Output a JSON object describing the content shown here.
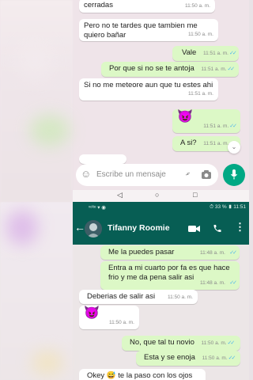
{
  "top_chat": {
    "messages": [
      {
        "dir": "in",
        "text": "cerradas",
        "time": "11:50 a. m."
      },
      {
        "dir": "in",
        "text": "Pero no te tardes que tambien me",
        "text2": "quiero bañar",
        "time": "11:50 a. m."
      },
      {
        "dir": "out",
        "text": "Vale",
        "time": "11:51 a. m."
      },
      {
        "dir": "out",
        "text": "Por que si no se te antoja",
        "time": "11:51 a. m."
      },
      {
        "dir": "in",
        "text": "Si no me meteore aun que tu estes ahi",
        "time": "11:51 a. m."
      },
      {
        "dir": "out",
        "text": "😈",
        "time": "11:51 a. m."
      },
      {
        "dir": "out",
        "text": "A si?",
        "time": "11:51 a. m."
      }
    ],
    "input_placeholder": "Escribe un mensaje"
  },
  "bottom_chat": {
    "status": {
      "left": "ᵛᵒˡᵗᵉ ▾ ◉",
      "right": "⏱ 33 % ▮ 11:51"
    },
    "contact_name": "Tifanny Roomie",
    "messages": [
      {
        "dir": "out",
        "text": "Me la puedes pasar",
        "time": "11:48 a. m."
      },
      {
        "dir": "out",
        "text": "Entra a mi cuarto por fa es que hace",
        "text2": "frio y me da pena salir asi",
        "time": "11:48 a. m."
      },
      {
        "dir": "in",
        "text": "Deberias de salir asi",
        "time": "11:50 a. m."
      },
      {
        "dir": "in",
        "text": "😈",
        "time": "11:50 a. m."
      },
      {
        "dir": "out",
        "text": "No, que tal tu novio",
        "time": "11:50 a. m."
      },
      {
        "dir": "out",
        "text": "Esta y se enoja",
        "time": "11:50 a. m."
      },
      {
        "dir": "in",
        "text": "Okey 😅 te la paso con los ojos",
        "time": ""
      }
    ]
  },
  "colors": {
    "header": "#075e54",
    "outgoing": "#dcf8c6",
    "incoming": "#ffffff",
    "accent": "#00a884"
  },
  "icons": [
    "emoji-icon",
    "attach-icon",
    "camera-icon",
    "mic-icon",
    "back-icon",
    "video-call-icon",
    "phone-icon",
    "more-icon",
    "scroll-down-icon"
  ]
}
